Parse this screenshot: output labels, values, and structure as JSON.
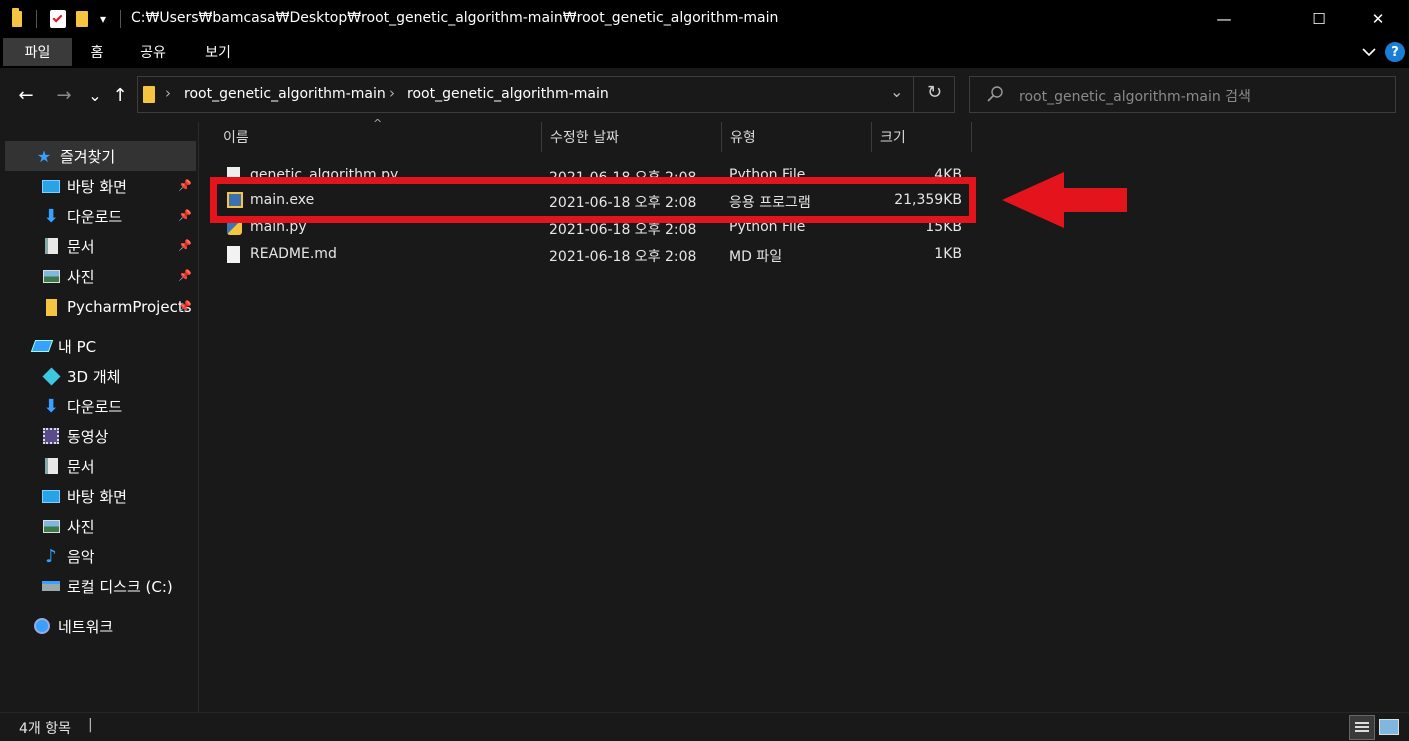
{
  "window": {
    "title_path": "C:₩Users₩bamcasa₩Desktop₩root_genetic_algorithm-main₩root_genetic_algorithm-main",
    "quick_access_dropdown": "▾",
    "controls": {
      "minimize": "—",
      "maximize": "☐",
      "close": "✕"
    }
  },
  "ribbon": {
    "tabs": [
      "파일",
      "홈",
      "공유",
      "보기"
    ],
    "expand_icon": "chevron-down-icon",
    "help_icon": "help-icon"
  },
  "navigation": {
    "back": "←",
    "forward": "→",
    "recent": "⌄",
    "up": "↑"
  },
  "address": {
    "crumbs": [
      "root_genetic_algorithm-main",
      "root_genetic_algorithm-main"
    ],
    "separator": "›",
    "dropdown": "⌄",
    "refresh": "↻"
  },
  "search": {
    "placeholder": "root_genetic_algorithm-main 검색"
  },
  "sidebar": {
    "quick_access": {
      "label": "즐겨찾기",
      "items": [
        {
          "label": "바탕 화면",
          "icon": "desktop-icon",
          "pinned": true
        },
        {
          "label": "다운로드",
          "icon": "download-icon",
          "pinned": true
        },
        {
          "label": "문서",
          "icon": "document-icon",
          "pinned": true
        },
        {
          "label": "사진",
          "icon": "pictures-icon",
          "pinned": true
        },
        {
          "label": "PycharmProjects",
          "icon": "folder-icon",
          "pinned": true
        }
      ]
    },
    "this_pc": {
      "label": "내 PC",
      "items": [
        {
          "label": "3D 개체",
          "icon": "3d-objects-icon"
        },
        {
          "label": "다운로드",
          "icon": "download-icon"
        },
        {
          "label": "동영상",
          "icon": "videos-icon"
        },
        {
          "label": "문서",
          "icon": "document-icon"
        },
        {
          "label": "바탕 화면",
          "icon": "desktop-icon"
        },
        {
          "label": "사진",
          "icon": "pictures-icon"
        },
        {
          "label": "음악",
          "icon": "music-icon"
        },
        {
          "label": "로컬 디스크 (C:)",
          "icon": "local-disk-icon"
        }
      ]
    },
    "network": {
      "label": "네트워크"
    }
  },
  "columns": {
    "name": "이름",
    "date": "수정한 날짜",
    "type": "유형",
    "size": "크기"
  },
  "files": [
    {
      "name": "genetic_algorithm.py",
      "date": "2021-06-18 오후 2:08",
      "type": "Python File",
      "size": "4KB",
      "icon": "python-file-icon"
    },
    {
      "name": "main.exe",
      "date": "2021-06-18 오후 2:08",
      "type": "응용 프로그램",
      "size": "21,359KB",
      "icon": "exe-file-icon"
    },
    {
      "name": "main.py",
      "date": "2021-06-18 오후 2:08",
      "type": "Python File",
      "size": "15KB",
      "icon": "python-file-icon"
    },
    {
      "name": "README.md",
      "date": "2021-06-18 오후 2:08",
      "type": "MD 파일",
      "size": "1KB",
      "icon": "text-file-icon"
    }
  ],
  "status": {
    "item_count": "4개 항목",
    "cursor": "|"
  },
  "colors": {
    "highlight": "#e3141c",
    "background": "#191919",
    "titlebar": "#000000",
    "accent_folder": "#f5c542"
  }
}
